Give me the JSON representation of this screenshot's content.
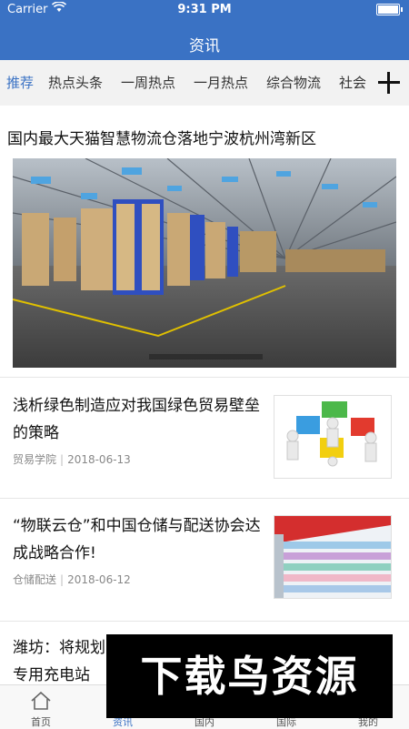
{
  "status_bar": {
    "carrier": "Carrier",
    "time": "9:31 PM"
  },
  "header": {
    "title": "资讯"
  },
  "tabs": [
    {
      "label": "推荐",
      "active": true
    },
    {
      "label": "热点头条"
    },
    {
      "label": "一周热点"
    },
    {
      "label": "一月热点"
    },
    {
      "label": "综合物流"
    },
    {
      "label": "社会"
    }
  ],
  "feature": {
    "title": "国内最大天猫智慧物流仓落地宁波杭州湾新区"
  },
  "articles": [
    {
      "title": "浅析绿色制造应对我国绿色贸易壁垒的策略",
      "source": "贸易学院",
      "date": "2018-06-13",
      "thumb": "puzzle-image"
    },
    {
      "title": "“物联云仓”和中国仓储与配送协会达成战略合作!",
      "source": "仓储配送",
      "date": "2018-06-12",
      "thumb": "supermarket-shelf-image"
    },
    {
      "title": "潍坊：将规划专用充电站"
    }
  ],
  "tabbar": [
    {
      "label": "首页",
      "icon": "home-icon"
    },
    {
      "label": "资讯",
      "icon": "news-icon",
      "active": true
    },
    {
      "label": "国内",
      "icon": "domestic-icon"
    },
    {
      "label": "国际",
      "icon": "globe-icon"
    },
    {
      "label": "我的",
      "icon": "profile-icon"
    }
  ],
  "watermark": {
    "text": "下载鸟资源"
  },
  "colors": {
    "accent": "#3a72c4"
  }
}
